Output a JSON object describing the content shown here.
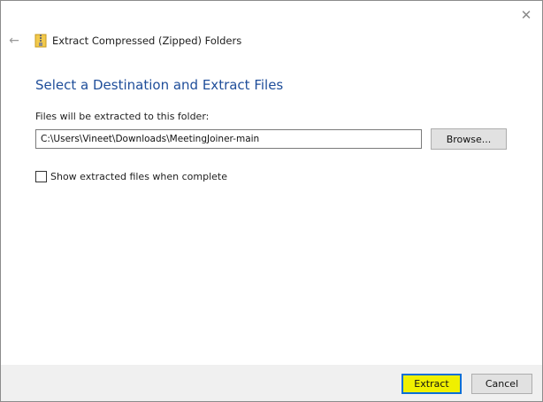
{
  "window": {
    "title": "Extract Compressed (Zipped) Folders",
    "close_icon": "close-icon",
    "back_icon": "back-arrow-icon",
    "title_icon": "zip-folder-icon"
  },
  "content": {
    "heading": "Select a Destination and Extract Files",
    "destination_label": "Files will be extracted to this folder:",
    "destination_path": "C:\\Users\\Vineet\\Downloads\\MeetingJoiner-main",
    "browse_label": "Browse...",
    "show_files_label": "Show extracted files when complete",
    "show_files_checked": false
  },
  "footer": {
    "extract_label": "Extract",
    "cancel_label": "Cancel"
  },
  "colors": {
    "heading": "#1f4e9a",
    "extract_highlight": "#f0f000",
    "focus_border": "#0b6fd6",
    "footer_bg": "#f0f0f0"
  }
}
